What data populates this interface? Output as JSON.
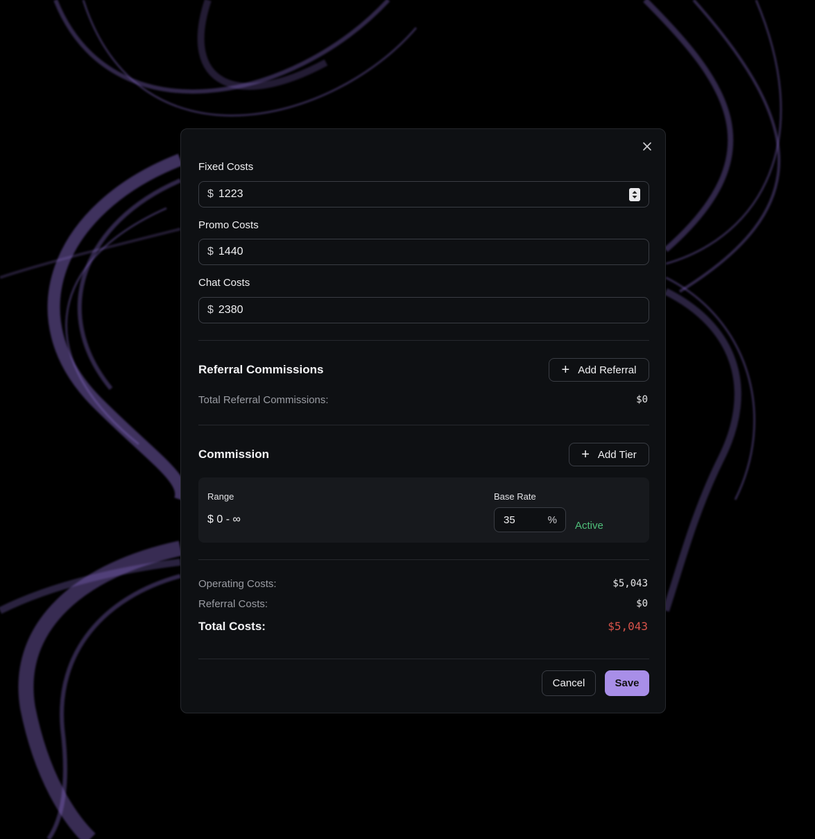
{
  "fields": [
    {
      "label": "Fixed Costs",
      "currency": "$",
      "value": "1223"
    },
    {
      "label": "Promo Costs",
      "currency": "$",
      "value": "1440"
    },
    {
      "label": "Chat Costs",
      "currency": "$",
      "value": "2380"
    }
  ],
  "referral": {
    "title": "Referral Commissions",
    "add_label": "Add Referral",
    "total_label": "Total Referral Commissions:",
    "total_value": "$0"
  },
  "commission": {
    "title": "Commission",
    "add_label": "Add Tier",
    "tier": {
      "range_label": "Range",
      "range_value": "$ 0 - ∞",
      "rate_label": "Base Rate",
      "rate_value": "35",
      "rate_unit": "%",
      "status": "Active"
    }
  },
  "summary": {
    "operating_label": "Operating Costs:",
    "operating_value": "$5,043",
    "referral_label": "Referral Costs:",
    "referral_value": "$0",
    "total_label": "Total Costs:",
    "total_value": "$5,043"
  },
  "actions": {
    "cancel_label": "Cancel",
    "save_label": "Save"
  },
  "colors": {
    "accent": "#a88ee8",
    "active": "#4fbf7a",
    "total": "#d9534a"
  }
}
